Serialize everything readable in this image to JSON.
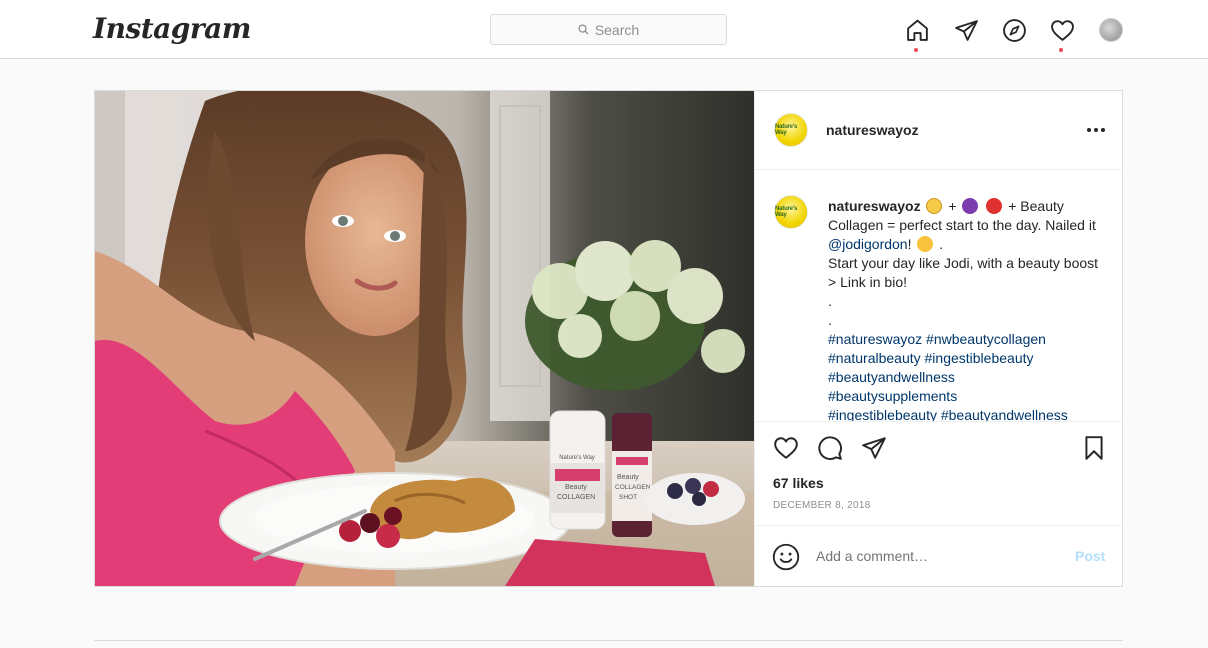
{
  "header": {
    "logo": "Instagram",
    "search_placeholder": "Search"
  },
  "post": {
    "username": "natureswayoz",
    "avatar_label": "Nature's Way",
    "caption": {
      "username": "natureswayoz",
      "text_1": "+",
      "text_2": "+ Beauty Collagen = perfect start to the day. Nailed it",
      "mention": "@jodigordon",
      "text_3": "!",
      "text_4": ".",
      "line_2": "Start your day like Jodi, with a beauty boost > Link in bio!",
      "dot_1": ".",
      "dot_2": ".",
      "hashtags": [
        "#natureswayoz #nwbeautycollagen",
        "#naturalbeauty #ingestiblebeauty",
        "#beautyandwellness",
        "#beautysupplements",
        "#ingestiblebeauty #beautyandwellness"
      ]
    },
    "likes": "67 likes",
    "date": "December 8, 2018",
    "comment_placeholder": "Add a comment…",
    "post_button": "Post",
    "photo_labels": {
      "bottle_brand": "Nature's Way",
      "bottle_1_line_1": "Beauty",
      "bottle_1_line_2": "COLLAGEN",
      "bottle_2_line_1": "Beauty",
      "bottle_2_line_2": "COLLAGEN",
      "bottle_2_line_3": "SHOT"
    }
  },
  "colors": {
    "notification_dot": "#ed4956",
    "link": "#00376b",
    "post_button_disabled": "#b2dffc",
    "brand_yellow": "#f2d400"
  },
  "icons": [
    "home-icon",
    "direct-icon",
    "explore-icon",
    "heart-icon",
    "search-icon",
    "comment-icon",
    "share-icon",
    "bookmark-icon",
    "emoji-icon",
    "more-options-icon"
  ]
}
